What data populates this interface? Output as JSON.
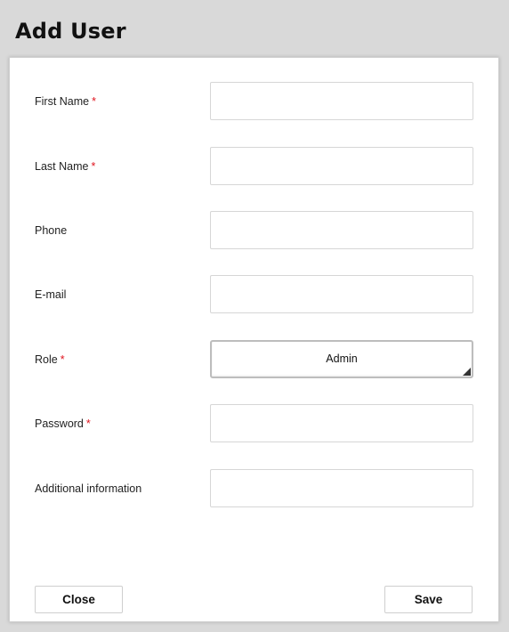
{
  "dialog": {
    "title": "Add User"
  },
  "form": {
    "required_marker": "*",
    "fields": [
      {
        "label": "First Name",
        "value": "",
        "required": true
      },
      {
        "label": "Last Name",
        "value": "",
        "required": true
      },
      {
        "label": "Phone",
        "value": "",
        "required": false
      },
      {
        "label": "E-mail",
        "value": "",
        "required": false
      },
      {
        "label": "Role",
        "value": "Admin",
        "required": true
      },
      {
        "label": "Password",
        "value": "",
        "required": true
      },
      {
        "label": "Additional information",
        "value": "",
        "required": false
      }
    ]
  },
  "actions": {
    "close_label": "Close",
    "save_label": "Save"
  },
  "colors": {
    "background": "#d9d9d9",
    "panel": "#ffffff",
    "required": "#e0141e"
  }
}
